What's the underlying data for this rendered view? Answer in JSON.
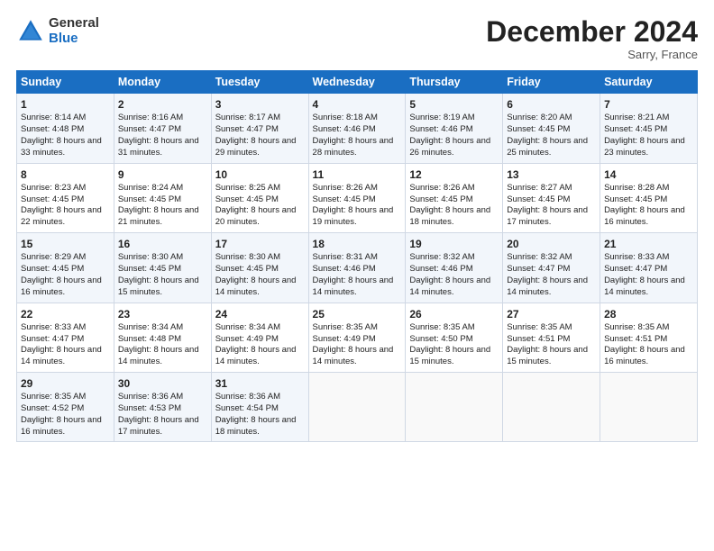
{
  "header": {
    "logo_general": "General",
    "logo_blue": "Blue",
    "title": "December 2024",
    "location": "Sarry, France"
  },
  "days_of_week": [
    "Sunday",
    "Monday",
    "Tuesday",
    "Wednesday",
    "Thursday",
    "Friday",
    "Saturday"
  ],
  "weeks": [
    [
      {
        "day": "1",
        "sunrise": "Sunrise: 8:14 AM",
        "sunset": "Sunset: 4:48 PM",
        "daylight": "Daylight: 8 hours and 33 minutes."
      },
      {
        "day": "2",
        "sunrise": "Sunrise: 8:16 AM",
        "sunset": "Sunset: 4:47 PM",
        "daylight": "Daylight: 8 hours and 31 minutes."
      },
      {
        "day": "3",
        "sunrise": "Sunrise: 8:17 AM",
        "sunset": "Sunset: 4:47 PM",
        "daylight": "Daylight: 8 hours and 29 minutes."
      },
      {
        "day": "4",
        "sunrise": "Sunrise: 8:18 AM",
        "sunset": "Sunset: 4:46 PM",
        "daylight": "Daylight: 8 hours and 28 minutes."
      },
      {
        "day": "5",
        "sunrise": "Sunrise: 8:19 AM",
        "sunset": "Sunset: 4:46 PM",
        "daylight": "Daylight: 8 hours and 26 minutes."
      },
      {
        "day": "6",
        "sunrise": "Sunrise: 8:20 AM",
        "sunset": "Sunset: 4:45 PM",
        "daylight": "Daylight: 8 hours and 25 minutes."
      },
      {
        "day": "7",
        "sunrise": "Sunrise: 8:21 AM",
        "sunset": "Sunset: 4:45 PM",
        "daylight": "Daylight: 8 hours and 23 minutes."
      }
    ],
    [
      {
        "day": "8",
        "sunrise": "Sunrise: 8:23 AM",
        "sunset": "Sunset: 4:45 PM",
        "daylight": "Daylight: 8 hours and 22 minutes."
      },
      {
        "day": "9",
        "sunrise": "Sunrise: 8:24 AM",
        "sunset": "Sunset: 4:45 PM",
        "daylight": "Daylight: 8 hours and 21 minutes."
      },
      {
        "day": "10",
        "sunrise": "Sunrise: 8:25 AM",
        "sunset": "Sunset: 4:45 PM",
        "daylight": "Daylight: 8 hours and 20 minutes."
      },
      {
        "day": "11",
        "sunrise": "Sunrise: 8:26 AM",
        "sunset": "Sunset: 4:45 PM",
        "daylight": "Daylight: 8 hours and 19 minutes."
      },
      {
        "day": "12",
        "sunrise": "Sunrise: 8:26 AM",
        "sunset": "Sunset: 4:45 PM",
        "daylight": "Daylight: 8 hours and 18 minutes."
      },
      {
        "day": "13",
        "sunrise": "Sunrise: 8:27 AM",
        "sunset": "Sunset: 4:45 PM",
        "daylight": "Daylight: 8 hours and 17 minutes."
      },
      {
        "day": "14",
        "sunrise": "Sunrise: 8:28 AM",
        "sunset": "Sunset: 4:45 PM",
        "daylight": "Daylight: 8 hours and 16 minutes."
      }
    ],
    [
      {
        "day": "15",
        "sunrise": "Sunrise: 8:29 AM",
        "sunset": "Sunset: 4:45 PM",
        "daylight": "Daylight: 8 hours and 16 minutes."
      },
      {
        "day": "16",
        "sunrise": "Sunrise: 8:30 AM",
        "sunset": "Sunset: 4:45 PM",
        "daylight": "Daylight: 8 hours and 15 minutes."
      },
      {
        "day": "17",
        "sunrise": "Sunrise: 8:30 AM",
        "sunset": "Sunset: 4:45 PM",
        "daylight": "Daylight: 8 hours and 14 minutes."
      },
      {
        "day": "18",
        "sunrise": "Sunrise: 8:31 AM",
        "sunset": "Sunset: 4:46 PM",
        "daylight": "Daylight: 8 hours and 14 minutes."
      },
      {
        "day": "19",
        "sunrise": "Sunrise: 8:32 AM",
        "sunset": "Sunset: 4:46 PM",
        "daylight": "Daylight: 8 hours and 14 minutes."
      },
      {
        "day": "20",
        "sunrise": "Sunrise: 8:32 AM",
        "sunset": "Sunset: 4:47 PM",
        "daylight": "Daylight: 8 hours and 14 minutes."
      },
      {
        "day": "21",
        "sunrise": "Sunrise: 8:33 AM",
        "sunset": "Sunset: 4:47 PM",
        "daylight": "Daylight: 8 hours and 14 minutes."
      }
    ],
    [
      {
        "day": "22",
        "sunrise": "Sunrise: 8:33 AM",
        "sunset": "Sunset: 4:47 PM",
        "daylight": "Daylight: 8 hours and 14 minutes."
      },
      {
        "day": "23",
        "sunrise": "Sunrise: 8:34 AM",
        "sunset": "Sunset: 4:48 PM",
        "daylight": "Daylight: 8 hours and 14 minutes."
      },
      {
        "day": "24",
        "sunrise": "Sunrise: 8:34 AM",
        "sunset": "Sunset: 4:49 PM",
        "daylight": "Daylight: 8 hours and 14 minutes."
      },
      {
        "day": "25",
        "sunrise": "Sunrise: 8:35 AM",
        "sunset": "Sunset: 4:49 PM",
        "daylight": "Daylight: 8 hours and 14 minutes."
      },
      {
        "day": "26",
        "sunrise": "Sunrise: 8:35 AM",
        "sunset": "Sunset: 4:50 PM",
        "daylight": "Daylight: 8 hours and 15 minutes."
      },
      {
        "day": "27",
        "sunrise": "Sunrise: 8:35 AM",
        "sunset": "Sunset: 4:51 PM",
        "daylight": "Daylight: 8 hours and 15 minutes."
      },
      {
        "day": "28",
        "sunrise": "Sunrise: 8:35 AM",
        "sunset": "Sunset: 4:51 PM",
        "daylight": "Daylight: 8 hours and 16 minutes."
      }
    ],
    [
      {
        "day": "29",
        "sunrise": "Sunrise: 8:35 AM",
        "sunset": "Sunset: 4:52 PM",
        "daylight": "Daylight: 8 hours and 16 minutes."
      },
      {
        "day": "30",
        "sunrise": "Sunrise: 8:36 AM",
        "sunset": "Sunset: 4:53 PM",
        "daylight": "Daylight: 8 hours and 17 minutes."
      },
      {
        "day": "31",
        "sunrise": "Sunrise: 8:36 AM",
        "sunset": "Sunset: 4:54 PM",
        "daylight": "Daylight: 8 hours and 18 minutes."
      },
      null,
      null,
      null,
      null
    ]
  ]
}
